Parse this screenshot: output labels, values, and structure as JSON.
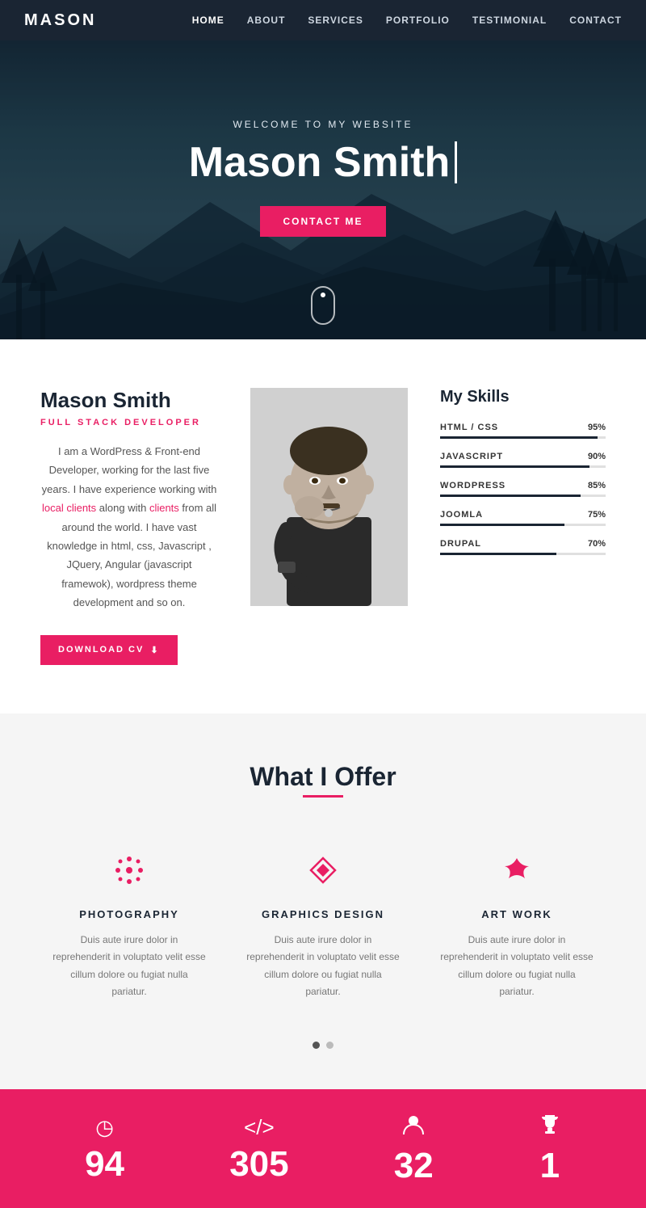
{
  "nav": {
    "logo": "MASON",
    "links": [
      {
        "label": "HOME",
        "active": true
      },
      {
        "label": "ABOUT",
        "active": false
      },
      {
        "label": "SERVICES",
        "active": false
      },
      {
        "label": "PORTFOLIO",
        "active": false
      },
      {
        "label": "TESTIMONIAL",
        "active": false
      },
      {
        "label": "CONTACT",
        "active": false
      }
    ]
  },
  "hero": {
    "subtitle": "WELCOME TO MY WEBSITE",
    "name": "Mason Smith",
    "cta": "CONTACT ME"
  },
  "about": {
    "name": "Mason Smith",
    "role": "FULL STACK DEVELOPER",
    "description": "I am a WordPress & Front-end Developer, working for the last five years. I have experience working with local clients along with clients from all around the world. I have vast knowledge in html, css, Javascript , JQuery, Angular (javascript framewok), wordpress theme development and so on.",
    "download_btn": "DOWNLOAD CV"
  },
  "skills": {
    "title": "My Skills",
    "items": [
      {
        "name": "HTML / CSS",
        "pct": 95,
        "label": "95%"
      },
      {
        "name": "JAVASCRIPT",
        "pct": 90,
        "label": "90%"
      },
      {
        "name": "WORDPRESS",
        "pct": 85,
        "label": "85%"
      },
      {
        "name": "JOOMLA",
        "pct": 75,
        "label": "75%"
      },
      {
        "name": "DRUPAL",
        "pct": 70,
        "label": "70%"
      }
    ]
  },
  "services": {
    "title": "What I Offer",
    "items": [
      {
        "icon": "✿",
        "name": "PHOTOGRAPHY",
        "desc": "Duis aute irure dolor in reprehenderit in voluptato velit esse cillum dolore ou fugiat nulla pariatur."
      },
      {
        "icon": "⌘",
        "name": "GRAPHICS DESIGN",
        "desc": "Duis aute irure dolor in reprehenderit in voluptato velit esse cillum dolore ou fugiat nulla pariatur."
      },
      {
        "icon": "❖",
        "name": "ART WORK",
        "desc": "Duis aute irure dolor in reprehenderit in voluptato velit esse cillum dolore ou fugiat nulla pariatur."
      }
    ]
  },
  "stats": {
    "items": [
      {
        "icon": "◷",
        "number": "94"
      },
      {
        "icon": "</>",
        "number": "305"
      },
      {
        "icon": "👤",
        "number": "32"
      },
      {
        "icon": "🏆",
        "number": "1"
      }
    ]
  }
}
